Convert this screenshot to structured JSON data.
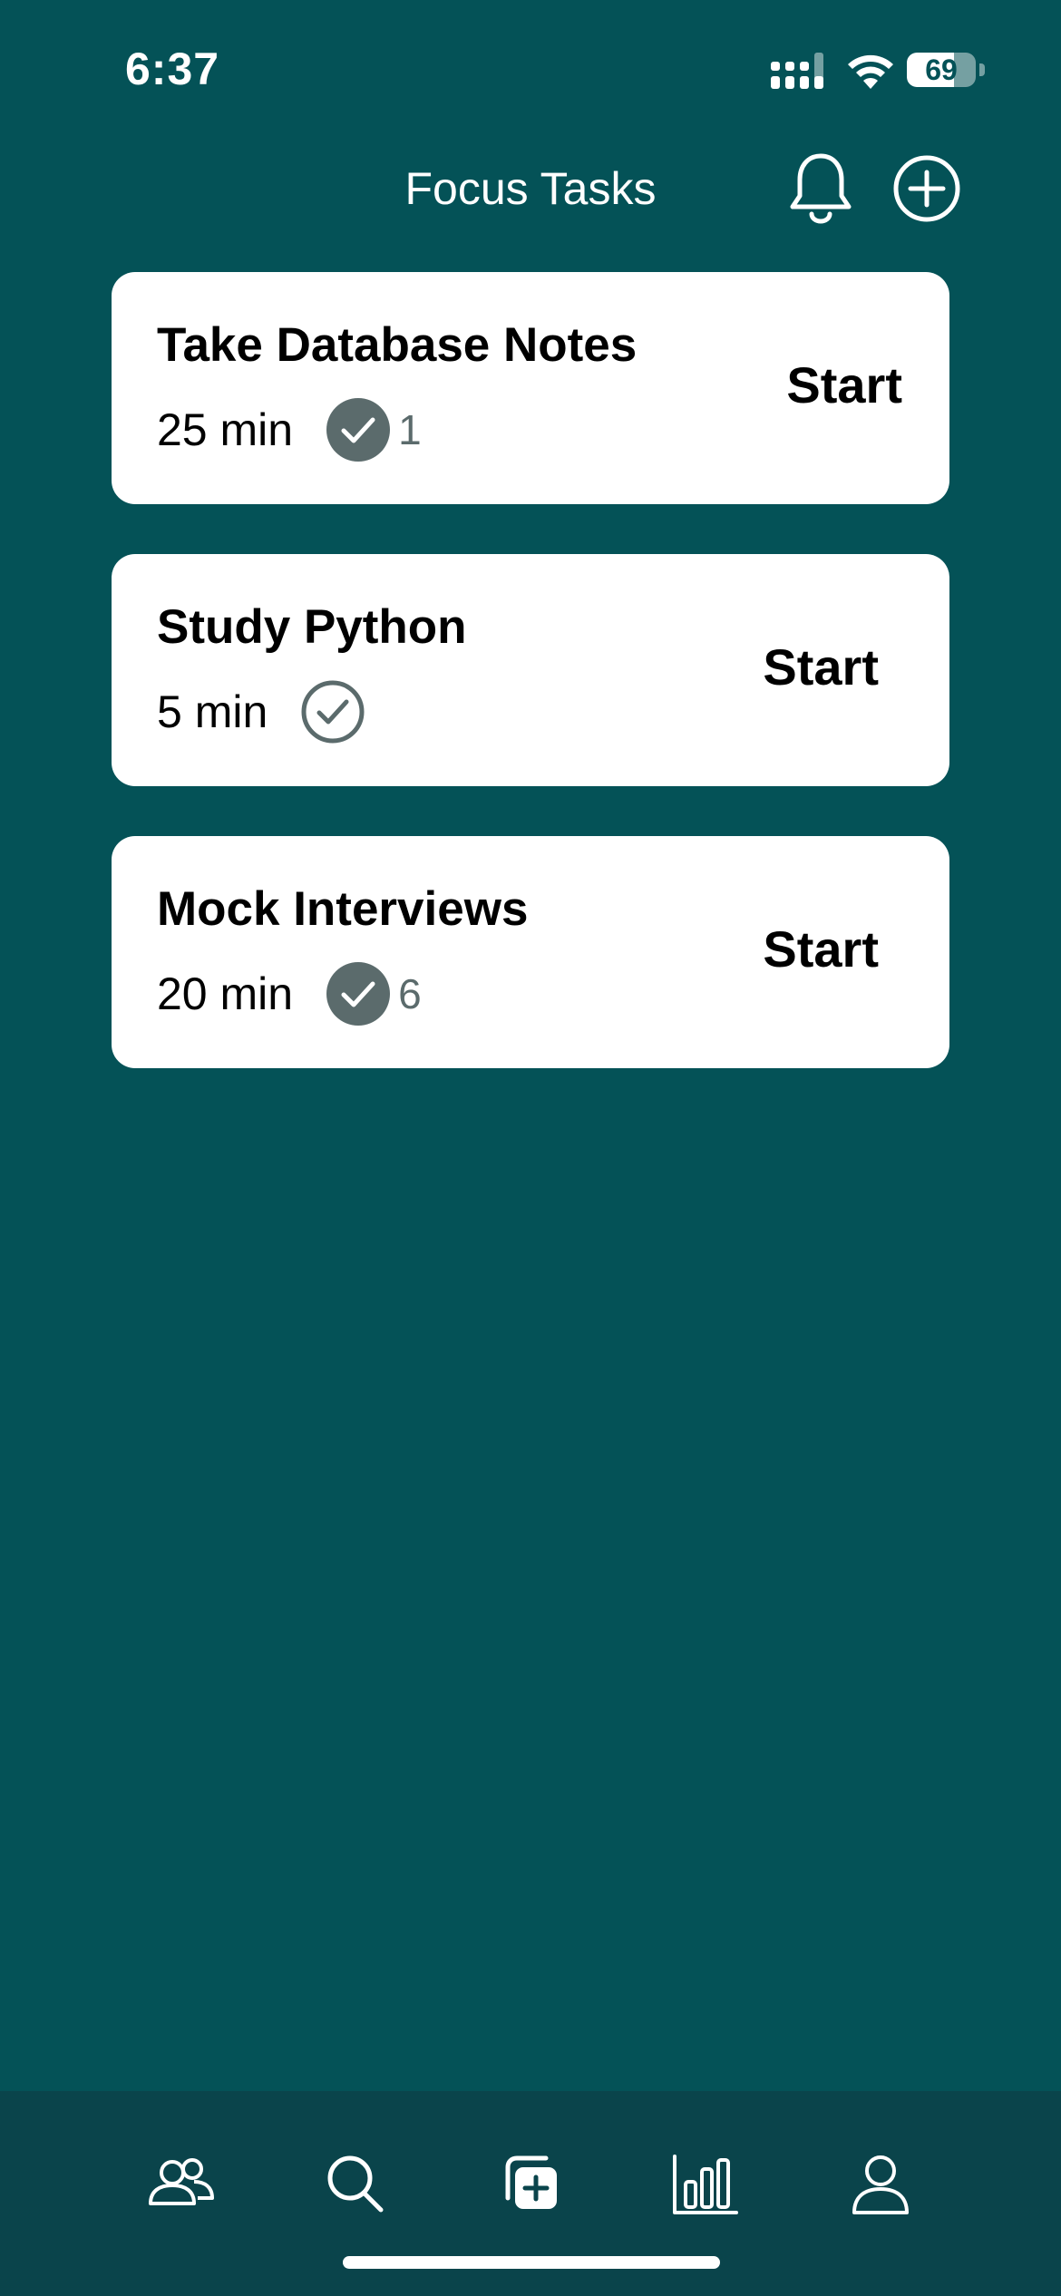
{
  "status_bar": {
    "time": "6:37",
    "battery_level": "69"
  },
  "header": {
    "title": "Focus Tasks",
    "notifications_icon": "bell-icon",
    "add_icon": "plus-circle-icon"
  },
  "tasks": [
    {
      "title": "Take Database Notes",
      "duration": "25 min",
      "completed_count": "1",
      "check_style": "filled",
      "start_label": "Start"
    },
    {
      "title": "Study Python",
      "duration": "5 min",
      "completed_count": "",
      "check_style": "outline",
      "start_label": "Start"
    },
    {
      "title": "Mock Interviews",
      "duration": "20 min",
      "completed_count": "6",
      "check_style": "filled",
      "start_label": "Start"
    }
  ],
  "tab_bar": {
    "items": [
      {
        "icon": "people-icon"
      },
      {
        "icon": "search-icon"
      },
      {
        "icon": "add-task-icon"
      },
      {
        "icon": "stats-icon"
      },
      {
        "icon": "profile-icon"
      }
    ]
  },
  "colors": {
    "background": "#045257",
    "tab_bar": "#0a444b",
    "card": "#ffffff",
    "check_filled": "#5b6b6c"
  }
}
